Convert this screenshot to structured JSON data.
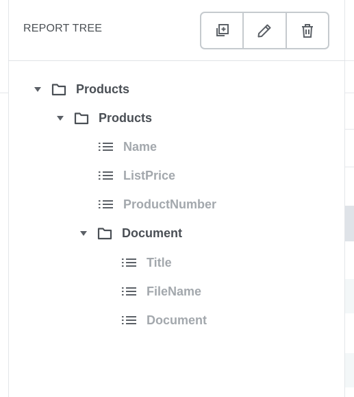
{
  "panel": {
    "title": "REPORT TREE"
  },
  "toolbar": {
    "buttons": [
      {
        "name": "add-report-button",
        "icon": "copy-plus-icon"
      },
      {
        "name": "edit-report-button",
        "icon": "pencil-icon"
      },
      {
        "name": "delete-report-button",
        "icon": "trash-icon"
      }
    ]
  },
  "tree": {
    "root": {
      "label": "Products",
      "expanded": true,
      "child": {
        "label": "Products",
        "expanded": true,
        "fields": [
          "Name",
          "ListPrice",
          "ProductNumber"
        ],
        "child": {
          "label": "Document",
          "expanded": true,
          "fields": [
            "Title",
            "FileName",
            "Document"
          ]
        }
      }
    }
  },
  "colors": {
    "folder_text": "#4a4f55",
    "field_text": "#a3a8ad",
    "border": "#c5cace"
  }
}
